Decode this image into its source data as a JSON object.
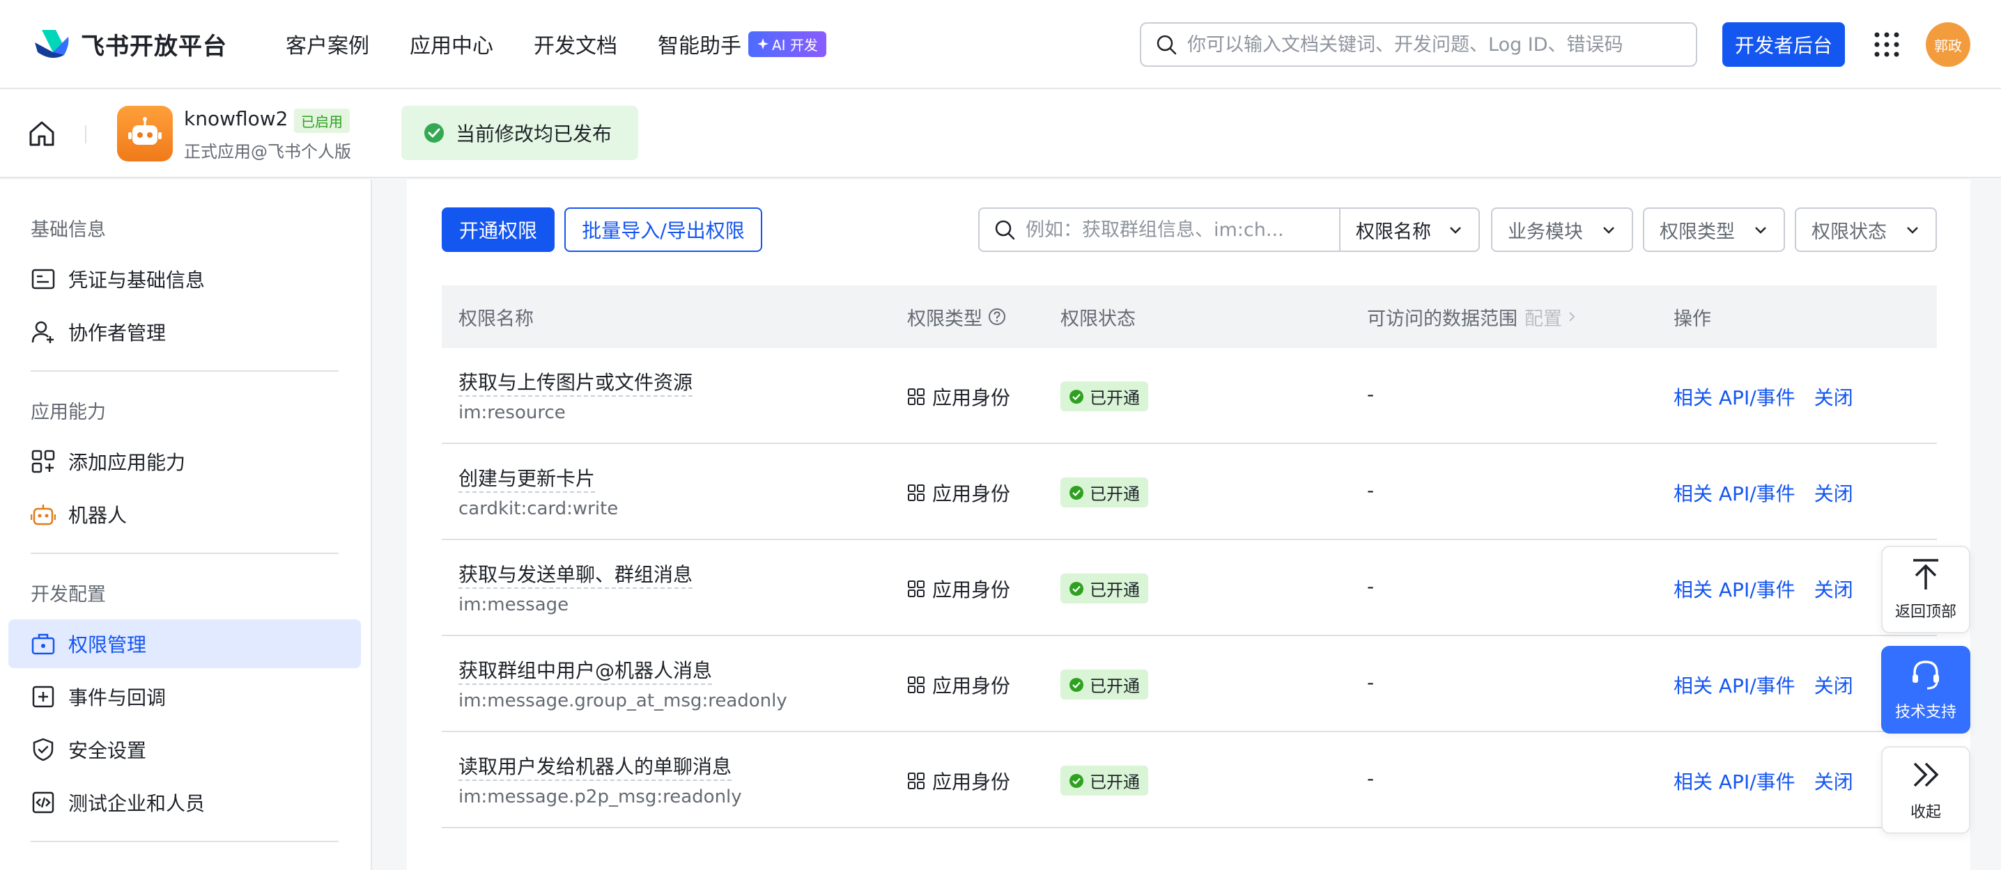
{
  "nav": {
    "brand": "飞书开放平台",
    "links": [
      "客户案例",
      "应用中心",
      "开发文档",
      "智能助手"
    ],
    "ai_badge": "AI 开发",
    "search_placeholder": "你可以输入文档关键词、开发问题、Log ID、错误码",
    "dev_console": "开发者后台",
    "avatar_text": "郭政"
  },
  "app": {
    "name": "knowflow2",
    "badge": "已启用",
    "subtitle": "正式应用@飞书个人版",
    "publish_status": "当前修改均已发布"
  },
  "sidebar": {
    "group1": "基础信息",
    "item_credentials": "凭证与基础信息",
    "item_collaborators": "协作者管理",
    "group2": "应用能力",
    "item_add_capability": "添加应用能力",
    "item_bot": "机器人",
    "group3": "开发配置",
    "item_permissions": "权限管理",
    "item_events": "事件与回调",
    "item_security": "安全设置",
    "item_test": "测试企业和人员"
  },
  "toolbar": {
    "enable_btn": "开通权限",
    "import_btn": "批量导入/导出权限",
    "search_placeholder": "例如：获取群组信息、im:ch...",
    "filter_name": "权限名称",
    "filter_module": "业务模块",
    "filter_type": "权限类型",
    "filter_status": "权限状态"
  },
  "table": {
    "headers": {
      "name": "权限名称",
      "type": "权限类型",
      "status": "权限状态",
      "scope": "可访问的数据范围",
      "scope_config": "配置",
      "action": "操作"
    },
    "rows": [
      {
        "name": "获取与上传图片或文件资源",
        "code": "im:resource",
        "type": "应用身份",
        "status": "已开通",
        "scope": "-",
        "api": "相关 API/事件",
        "close": "关闭"
      },
      {
        "name": "创建与更新卡片",
        "code": "cardkit:card:write",
        "type": "应用身份",
        "status": "已开通",
        "scope": "-",
        "api": "相关 API/事件",
        "close": "关闭"
      },
      {
        "name": "获取与发送单聊、群组消息",
        "code": "im:message",
        "type": "应用身份",
        "status": "已开通",
        "scope": "-",
        "api": "相关 API/事件",
        "close": "关闭"
      },
      {
        "name": "获取群组中用户@机器人消息",
        "code": "im:message.group_at_msg:readonly",
        "type": "应用身份",
        "status": "已开通",
        "scope": "-",
        "api": "相关 API/事件",
        "close": "关闭"
      },
      {
        "name": "读取用户发给机器人的单聊消息",
        "code": "im:message.p2p_msg:readonly",
        "type": "应用身份",
        "status": "已开通",
        "scope": "-",
        "api": "相关 API/事件",
        "close": "关闭"
      }
    ]
  },
  "float": {
    "top": "返回顶部",
    "support": "技术支持",
    "collapse": "收起"
  }
}
